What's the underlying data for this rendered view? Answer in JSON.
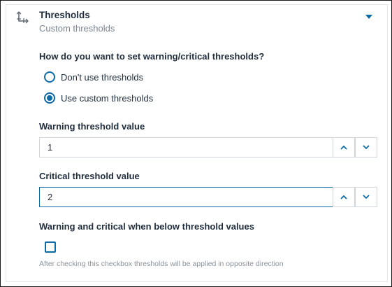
{
  "section": {
    "title": "Thresholds",
    "subtitle": "Custom thresholds",
    "icon": "axis-icon",
    "toggle_icon": "caret-down-icon"
  },
  "threshold_mode": {
    "question": "How do you want to set warning/critical thresholds?",
    "options": [
      {
        "label": "Don't use thresholds",
        "selected": false
      },
      {
        "label": "Use custom thresholds",
        "selected": true
      }
    ]
  },
  "warning": {
    "label": "Warning threshold value",
    "value": "1"
  },
  "critical": {
    "label": "Critical threshold value",
    "value": "2"
  },
  "below": {
    "label": "Warning and critical when below threshold values",
    "checked": false,
    "hint": "After checking this checkbox thresholds will be applied in opposite direction"
  },
  "colors": {
    "accent": "#0b6aa8",
    "text": "#1f2d3d",
    "muted": "#7a8591",
    "border": "#d0d5da"
  }
}
